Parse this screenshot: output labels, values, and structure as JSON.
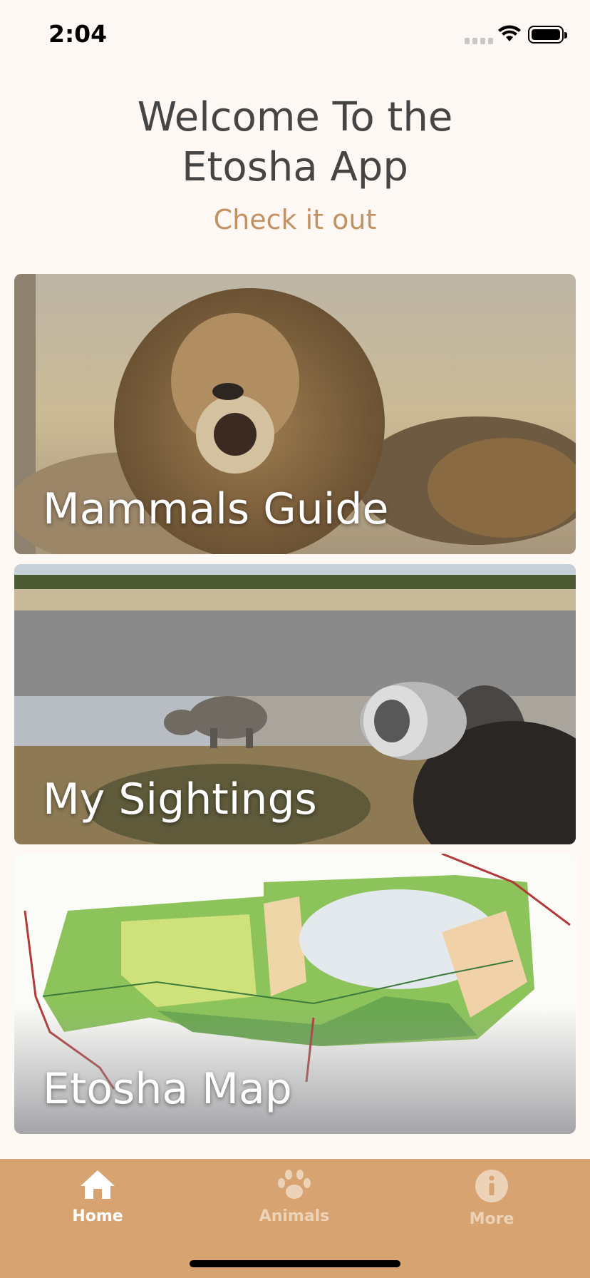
{
  "status": {
    "time": "2:04"
  },
  "header": {
    "title_line1": "Welcome To the",
    "title_line2": "Etosha App",
    "subtitle": "Check it out"
  },
  "cards": [
    {
      "label": "Mammals Guide",
      "image": "lion-photo"
    },
    {
      "label": "My Sightings",
      "image": "rhino-photographer-photo"
    },
    {
      "label": "Etosha Map",
      "image": "etosha-park-map"
    }
  ],
  "tabs": [
    {
      "label": "Home",
      "icon": "home-icon",
      "active": true
    },
    {
      "label": "Animals",
      "icon": "paw-icon",
      "active": false
    },
    {
      "label": "More",
      "icon": "info-icon",
      "active": false
    }
  ],
  "colors": {
    "background": "#fdf8f3",
    "accent": "#c39262",
    "tab_bar": "#d6a371",
    "title": "#454545"
  }
}
